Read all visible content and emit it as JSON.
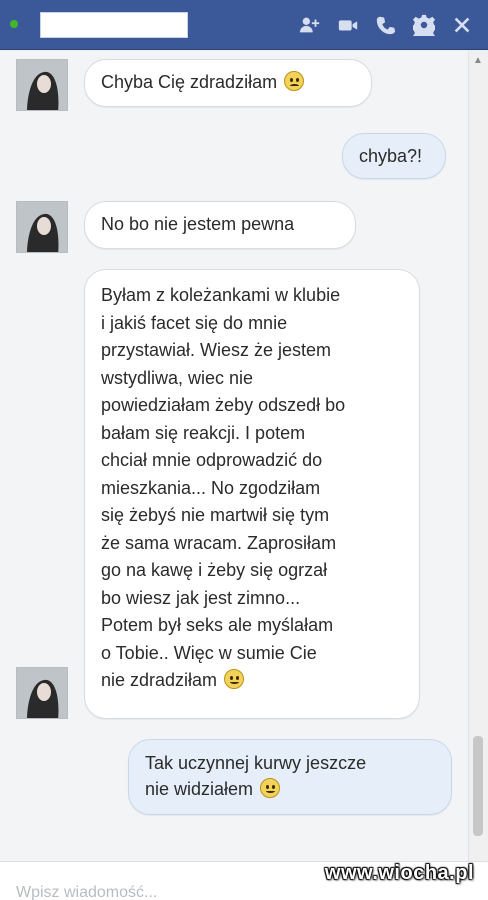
{
  "header": {
    "status": "online",
    "contact_name": "",
    "icons": [
      "add-people-icon",
      "video-call-icon",
      "phone-call-icon",
      "settings-gear-icon",
      "close-icon"
    ]
  },
  "messages": [
    {
      "sender": "contact",
      "text": "Chyba Cię zdradziłam",
      "emoji": "sad"
    },
    {
      "sender": "me",
      "text": "chyba?!"
    },
    {
      "sender": "contact",
      "text": "No bo nie jestem pewna"
    },
    {
      "sender": "contact",
      "lines": [
        "Byłam z koleżankami w klubie",
        "i jakiś facet się do mnie",
        "przystawiał. Wiesz że jestem",
        "wstydliwa, wiec nie",
        "powiedziałam żeby odszedł bo",
        "bałam się reakcji. I potem",
        "chciał mnie odprowadzić do",
        "mieszkania... No zgodziłam",
        "się żebyś nie martwił się tym",
        "że sama wracam. Zaprosiłam",
        "go na kawę i żeby się ogrzał",
        "bo wiesz jak jest zimno...",
        "Potem był seks ale myślałam",
        "o Tobie.. Więc w sumie Cie",
        "nie zdradziłam"
      ],
      "emoji": "happy"
    },
    {
      "sender": "me",
      "lines": [
        "Tak uczynnej kurwy jeszcze",
        "nie widziałem"
      ],
      "emoji": "happy"
    }
  ],
  "input": {
    "placeholder": "Wpisz wiadomość..."
  },
  "watermark": "www.wiocha.pl",
  "colors": {
    "header": "#3b5998",
    "my_bubble": "#e6eef9",
    "their_bubble": "#ffffff"
  }
}
